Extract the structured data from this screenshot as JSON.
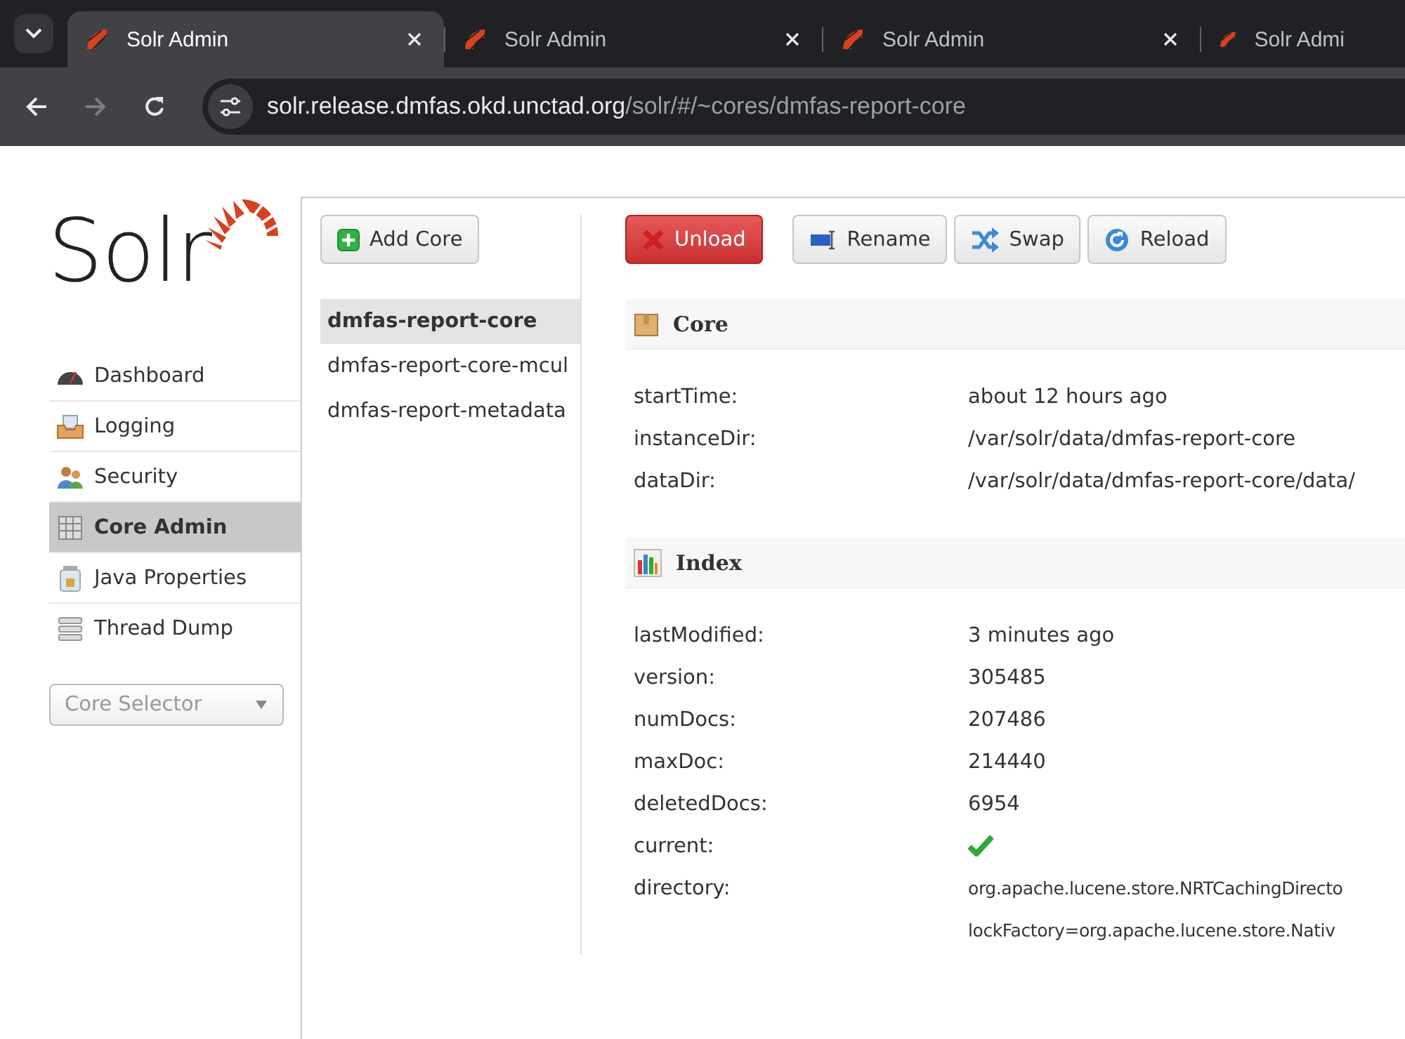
{
  "browser": {
    "tabs": [
      {
        "title": "Solr Admin",
        "selected": true
      },
      {
        "title": "Solr Admin",
        "selected": false
      },
      {
        "title": "Solr Admin",
        "selected": false
      },
      {
        "title": "Solr Admi",
        "selected": false
      }
    ],
    "url_host": "solr.release.dmfas.okd.unctad.org",
    "url_path": "/solr/#/~cores/dmfas-report-core"
  },
  "logo": {
    "text": "Solr"
  },
  "sidebar": {
    "items": [
      {
        "label": "Dashboard",
        "kind": "dashboard",
        "selected": false
      },
      {
        "label": "Logging",
        "kind": "logging",
        "selected": false
      },
      {
        "label": "Security",
        "kind": "security",
        "selected": false
      },
      {
        "label": "Core Admin",
        "kind": "cores",
        "selected": true
      },
      {
        "label": "Java Properties",
        "kind": "java",
        "selected": false
      },
      {
        "label": "Thread Dump",
        "kind": "threads",
        "selected": false
      }
    ],
    "core_selector": {
      "placeholder": "Core Selector"
    }
  },
  "add_core_button": "Add Core",
  "cores": [
    {
      "name": "dmfas-report-core",
      "selected": true
    },
    {
      "name": "dmfas-report-core-mcul",
      "selected": false
    },
    {
      "name": "dmfas-report-metadata",
      "selected": false
    }
  ],
  "actions": [
    {
      "label": "Unload",
      "kind": "unload"
    },
    {
      "label": "Rename",
      "kind": "rename"
    },
    {
      "label": "Swap",
      "kind": "swap"
    },
    {
      "label": "Reload",
      "kind": "reload"
    }
  ],
  "sections": [
    {
      "title": "Core",
      "kind": "core",
      "rows": [
        {
          "label": "startTime:",
          "values": [
            "about 12 hours ago"
          ]
        },
        {
          "label": "instanceDir:",
          "values": [
            "/var/solr/data/dmfas-report-core"
          ]
        },
        {
          "label": "dataDir:",
          "values": [
            "/var/solr/data/dmfas-report-core/data/"
          ]
        }
      ]
    },
    {
      "title": "Index",
      "kind": "index",
      "rows": [
        {
          "label": "lastModified:",
          "values": [
            "3 minutes ago"
          ]
        },
        {
          "label": "version:",
          "values": [
            "305485"
          ]
        },
        {
          "label": "numDocs:",
          "values": [
            "207486"
          ]
        },
        {
          "label": "maxDoc:",
          "values": [
            "214440"
          ]
        },
        {
          "label": "deletedDocs:",
          "values": [
            "6954"
          ]
        },
        {
          "label": "current:",
          "check": true
        },
        {
          "label": "directory:",
          "values": [
            "org.apache.lucene.store.NRTCachingDirecto",
            "lockFactory=org.apache.lucene.store.Nativ"
          ]
        }
      ]
    }
  ]
}
